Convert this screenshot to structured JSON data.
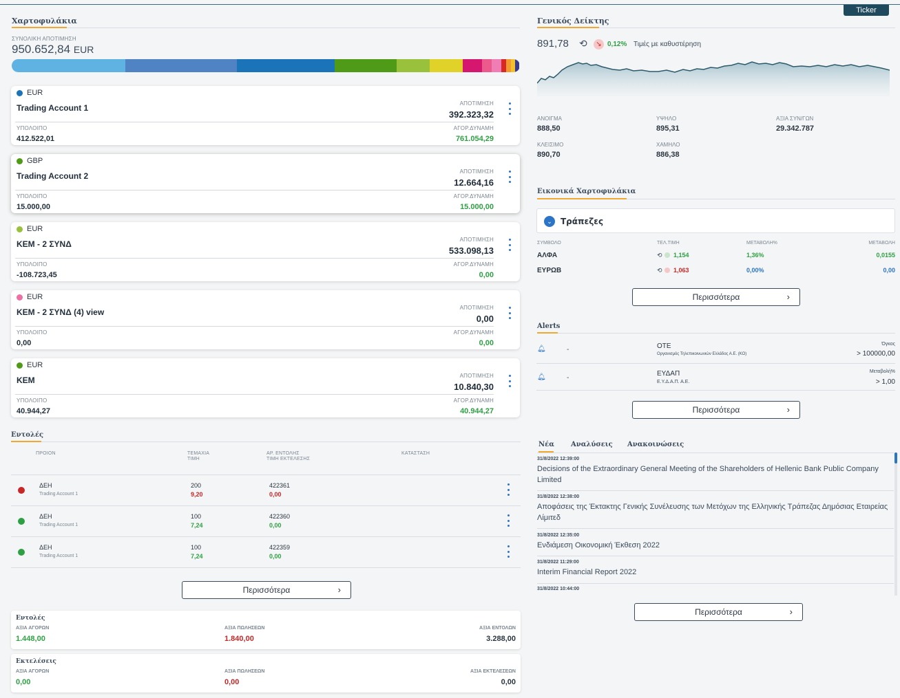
{
  "ticker_button": "Ticker",
  "portfolios": {
    "title": "Χαρτοφυλάκια",
    "total_label": "ΣΥΝΟΛΙΚΗ ΑΠΟΤΙΜΗΣΗ",
    "total_value": "950.652,84",
    "total_currency": "EUR",
    "allocation": [
      {
        "share": 0.224,
        "color": "#5fb3e3"
      },
      {
        "share": 0.219,
        "color": "#5083c4"
      },
      {
        "share": 0.193,
        "color": "#1b74b8"
      },
      {
        "share": 0.121,
        "color": "#4f9a16"
      },
      {
        "share": 0.066,
        "color": "#9ac13b"
      },
      {
        "share": 0.064,
        "color": "#e0d228"
      },
      {
        "share": 0.038,
        "color": "#d6176f"
      },
      {
        "share": 0.02,
        "color": "#ec5a8d"
      },
      {
        "share": 0.018,
        "color": "#f07db3"
      },
      {
        "share": 0.01,
        "color": "#d82828"
      },
      {
        "share": 0.009,
        "color": "#f29a2e"
      },
      {
        "share": 0.008,
        "color": "#f2c02e"
      },
      {
        "share": 0.008,
        "color": "#3a3a8a"
      }
    ],
    "valuation_label": "ΑΠΟΤΙΜΗΣΗ",
    "balance_label": "ΥΠΟΛΟΙΠΟ",
    "power_label": "ΑΓΟΡ.ΔΥΝΑΜΗ",
    "accounts": [
      {
        "currency": "EUR",
        "dot": "#1b74b8",
        "name": "Trading Account 1",
        "valuation": "392.323,32",
        "balance": "412.522,01",
        "power": "761.054,29",
        "power_color": "#2ea043"
      },
      {
        "currency": "GBP",
        "dot": "#4f9a16",
        "name": "Trading Account 2",
        "valuation": "12.664,16",
        "balance": "15.000,00",
        "power": "15.000,00",
        "power_color": "#2ea043"
      },
      {
        "currency": "EUR",
        "dot": "#9ac13b",
        "name": "ΚΕΜ - 2 ΣΥΝΔ",
        "valuation": "533.098,13",
        "balance": "-108.723,45",
        "power": "0,00",
        "power_color": "#2ea043"
      },
      {
        "currency": "EUR",
        "dot": "#ec6fa5",
        "name": "ΚΕΜ - 2 ΣΥΝΔ (4) view",
        "valuation": "0,00",
        "balance": "0,00",
        "power": "0,00",
        "power_color": "#2ea043"
      },
      {
        "currency": "EUR",
        "dot": "#4f9a16",
        "name": "ΚΕΜ",
        "valuation": "10.840,30",
        "balance": "40.944,27",
        "power": "40.944,27",
        "power_color": "#2ea043"
      }
    ]
  },
  "orders": {
    "title": "Εντολές",
    "headers": {
      "product": "ΠΡΟΙΟΝ",
      "qty": "ΤΕΜΑΧΙΑ",
      "price": "ΤΙΜΗ",
      "order_no": "ΑΡ. ΕΝΤΟΛΗΣ",
      "exec_price": "ΤΙΜΗ ΕΚΤΕΛΕΣΗΣ",
      "status": "ΚΑΤΑΣΤΑΣΗ"
    },
    "rows": [
      {
        "dot": "#c62828",
        "product": "ΔΕΗ",
        "account": "Trading Account 1",
        "qty": "200",
        "price": "9,20",
        "price_color": "#c62828",
        "order_no": "422361",
        "exec": "0,00",
        "exec_color": "#c62828"
      },
      {
        "dot": "#2ea043",
        "product": "ΔΕΗ",
        "account": "Trading Account 1",
        "qty": "100",
        "price": "7,24",
        "price_color": "#2ea043",
        "order_no": "422360",
        "exec": "0,00",
        "exec_color": "#2ea043"
      },
      {
        "dot": "#2ea043",
        "product": "ΔΕΗ",
        "account": "Trading Account 1",
        "qty": "100",
        "price": "7,24",
        "price_color": "#2ea043",
        "order_no": "422359",
        "exec": "0,00",
        "exec_color": "#2ea043"
      }
    ],
    "more": "Περισσότερα"
  },
  "orders_summary": {
    "title": "Εντολές",
    "buy_label": "ΑΞΙΑ ΑΓΟΡΩΝ",
    "buy_value": "1.448,00",
    "sell_label": "ΑΞΙΑ ΠΩΛΗΣΕΩΝ",
    "sell_value": "1.840,00",
    "total_label": "ΑΞΙΑ ΕΝΤΟΛΩΝ",
    "total_value": "3.288,00"
  },
  "executions_summary": {
    "title": "Εκτελέσεις",
    "buy_label": "ΑΞΙΑ ΑΓΟΡΩΝ",
    "buy_value": "0,00",
    "sell_label": "ΑΞΙΑ ΠΩΛΗΣΕΩΝ",
    "sell_value": "0,00",
    "total_label": "ΑΞΙΑ ΕΚΤΕΛΕΣΕΩΝ",
    "total_value": "0,00"
  },
  "index": {
    "title": "Γενικός Δείκτης",
    "value": "891,78",
    "change": "0,12%",
    "delay_note": "Τιμές με καθυστέρηση",
    "stats": {
      "open_label": "ΑΝΟΙΓΜΑ",
      "open": "888,50",
      "high_label": "ΥΨΗΛΟ",
      "high": "895,31",
      "turnover_label": "ΑΞΙΑ ΣΥΝ/ΓΩΝ",
      "turnover": "29.342.787",
      "close_label": "ΚΛΕΙΣΙΜΟ",
      "close": "890,70",
      "low_label": "ΧΑΜΗΛΟ",
      "low": "886,38"
    }
  },
  "virtual_portfolios": {
    "title": "Εικονικά Χαρτοφυλάκια",
    "selected": "Τράπεζες",
    "headers": {
      "symbol": "ΣΥΜΒΟΛΟ",
      "last": "ΤΕΛ.ΤΙΜΗ",
      "change_pct": "ΜΕΤΑΒΟΛΗ%",
      "change": "ΜΕΤΑΒΟΛΗ"
    },
    "rows": [
      {
        "symbol": "ΑΛΦΑ",
        "last": "1,154",
        "last_color": "#2ea043",
        "change_pct": "1,36%",
        "pct_color": "#2ea043",
        "change": "0,0155",
        "change_color": "#2ea043"
      },
      {
        "symbol": "ΕΥΡΩΒ",
        "last": "1,063",
        "last_color": "#c62828",
        "change_pct": "0,00%",
        "pct_color": "#2c74c5",
        "change": "0,00",
        "change_color": "#2c74c5"
      }
    ],
    "more": "Περισσότερα"
  },
  "alerts": {
    "title": "Alerts",
    "rows": [
      {
        "dash": "-",
        "symbol": "ΟΤΕ",
        "company": "Οργανισμός Τηλεπικοινωνιών Ελλάδος Α.Ε. (ΚΟ)",
        "cond_label": "Όγκος",
        "cond_value": "> 100000,00"
      },
      {
        "dash": "-",
        "symbol": "ΕΥΔΑΠ",
        "company": "Ε.Υ.Δ.Α.Π. Α.Ε.",
        "cond_label": "Μεταβολή%",
        "cond_value": "> 1,00"
      }
    ],
    "more": "Περισσότερα"
  },
  "news": {
    "tabs": [
      "Νέα",
      "Αναλύσεις",
      "Ανακοινώσεις"
    ],
    "items": [
      {
        "date": "31/8/2022 12:39:00",
        "title": "Decisions of the Extraordinary General Meeting of the Shareholders of Hellenic Bank Public Company Limited"
      },
      {
        "date": "31/8/2022 12:38:00",
        "title": "Αποφάσεις της Έκτακτης Γενικής Συνέλευσης των Μετόχων της Ελληνικής Τράπεζας Δημόσιας Εταιρείας Λίμιτεδ"
      },
      {
        "date": "31/8/2022 12:35:00",
        "title": "Ενδιάμεση Οικονομική Έκθεση 2022"
      },
      {
        "date": "31/8/2022 11:29:00",
        "title": "Interim Financial Report 2022"
      },
      {
        "date": "31/8/2022 10:44:00",
        "title": ""
      }
    ],
    "more": "Περισσότερα"
  }
}
